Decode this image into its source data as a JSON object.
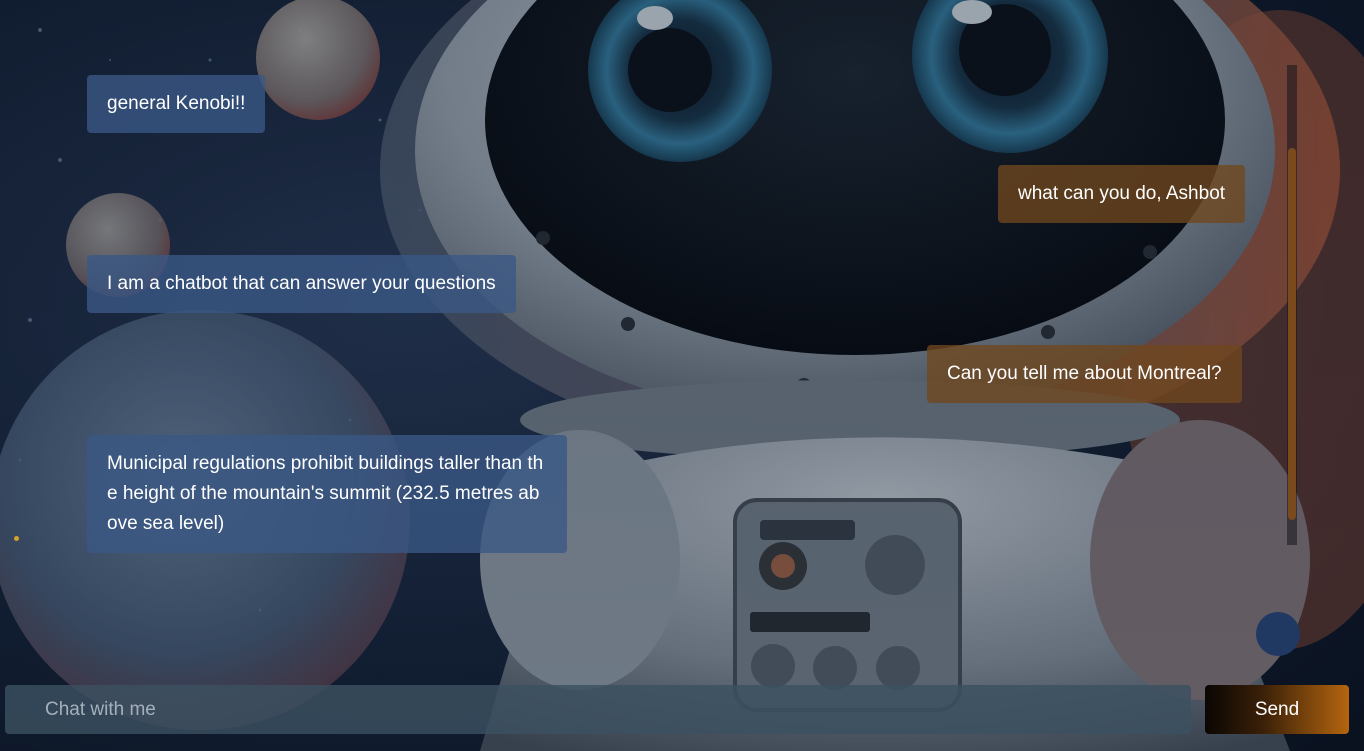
{
  "chat": {
    "messages": [
      {
        "role": "bot",
        "text": "general Kenobi!!"
      },
      {
        "role": "user",
        "text": "what can you do, Ashbot"
      },
      {
        "role": "bot",
        "text": "I am a chatbot that can answer your questions"
      },
      {
        "role": "user",
        "text": "Can you tell me about Montreal?"
      },
      {
        "role": "bot",
        "text": "Municipal regulations prohibit buildings taller than the height of the mountain's summit (232.5 metres above sea level)"
      }
    ]
  },
  "composer": {
    "placeholder": "Chat with me",
    "value": "",
    "send_label": "Send"
  },
  "colors": {
    "bot_bubble": "#3a5884",
    "user_bubble": "#70461e",
    "accent": "#b5650f",
    "scrollbar_thumb": "#7a4a1c"
  },
  "background": {
    "icon": "astronaut-robot-space-illustration"
  }
}
